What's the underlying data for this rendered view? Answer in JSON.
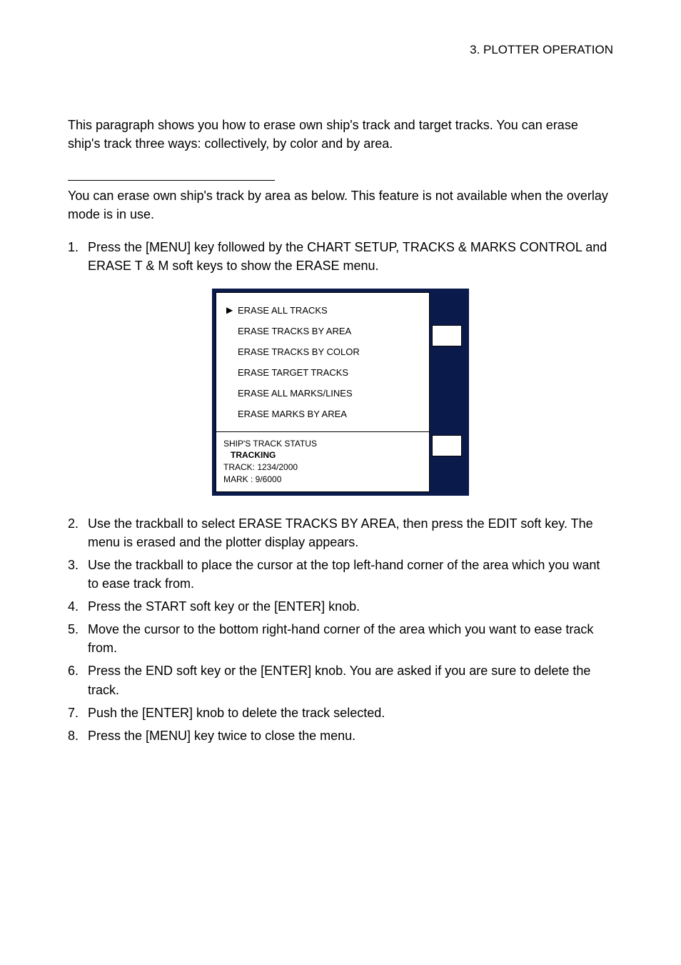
{
  "header": {
    "section_label": "3. PLOTTER OPERATION"
  },
  "intro_para": "This paragraph shows you how to erase own ship's track and target tracks. You can erase ship's track three ways: collectively, by color and by area.",
  "sub_para": "You can erase own ship's track by area as below. This feature is not available when the overlay mode is in use.",
  "steps_top": [
    {
      "num": "1.",
      "text": "Press the [MENU] key followed by the CHART SETUP, TRACKS & MARKS CONTROL and ERASE T & M soft keys to show the ERASE menu."
    }
  ],
  "menu": {
    "items": [
      {
        "arrow": true,
        "label": "ERASE ALL TRACKS"
      },
      {
        "arrow": false,
        "label": "ERASE TRACKS BY AREA"
      },
      {
        "arrow": false,
        "label": "ERASE TRACKS BY COLOR"
      },
      {
        "arrow": false,
        "label": "ERASE TARGET TRACKS"
      },
      {
        "arrow": false,
        "label": "ERASE ALL MARKS/LINES"
      },
      {
        "arrow": false,
        "label": "ERASE MARKS BY AREA"
      }
    ],
    "status": {
      "title": "SHIP'S TRACK STATUS",
      "tracking": "TRACKING",
      "track": "TRACK: 1234/2000",
      "mark": "MARK :      9/6000"
    }
  },
  "steps_bottom": [
    {
      "num": "2.",
      "text": "Use the trackball to select ERASE TRACKS BY AREA, then press the EDIT soft key. The menu is erased and the plotter display appears."
    },
    {
      "num": "3.",
      "text": "Use the trackball to place the cursor at the top left-hand corner of the area which you want to ease track from."
    },
    {
      "num": "4.",
      "text": "Press the START soft key or the [ENTER] knob."
    },
    {
      "num": "5.",
      "text": "Move the cursor to the bottom right-hand corner of the area which you want to ease track from."
    },
    {
      "num": "6.",
      "text": "Press the END soft key or the [ENTER] knob. You are asked if you are sure to delete the track."
    },
    {
      "num": "7.",
      "text": "Push the [ENTER] knob to delete the track selected."
    },
    {
      "num": "8.",
      "text": "Press the [MENU] key twice to close the menu."
    }
  ]
}
